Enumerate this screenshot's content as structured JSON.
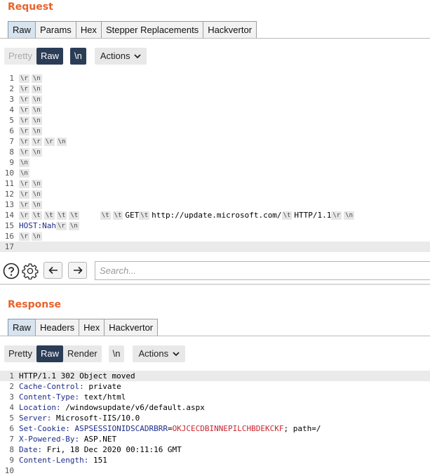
{
  "request": {
    "title": "Request",
    "tabs": [
      "Raw",
      "Params",
      "Hex",
      "Stepper Replacements",
      "Hackvertor"
    ],
    "toolbar": {
      "pretty": "Pretty",
      "raw": "Raw",
      "newline": "\\n",
      "actions": "Actions"
    },
    "lines": [
      {
        "n": "1",
        "html": "<span class='esc'>\\r</span><span class='esc'>\\n</span>"
      },
      {
        "n": "2",
        "html": "<span class='esc'>\\r</span><span class='esc'>\\n</span>"
      },
      {
        "n": "3",
        "html": "<span class='esc'>\\r</span><span class='esc'>\\n</span>"
      },
      {
        "n": "4",
        "html": "<span class='esc'>\\r</span><span class='esc'>\\n</span>"
      },
      {
        "n": "5",
        "html": "<span class='esc'>\\r</span><span class='esc'>\\n</span>"
      },
      {
        "n": "6",
        "html": "<span class='esc'>\\r</span><span class='esc'>\\n</span>"
      },
      {
        "n": "7",
        "html": "<span class='esc'>\\r</span><span class='esc'>\\r</span><span class='esc'>\\r</span><span class='esc'>\\n</span>"
      },
      {
        "n": "8",
        "html": "<span class='esc'>\\r</span><span class='esc'>\\n</span>"
      },
      {
        "n": "9",
        "html": "<span class='esc'>\\n</span>"
      },
      {
        "n": "10",
        "html": "<span class='esc'>\\n</span>"
      },
      {
        "n": "11",
        "html": "<span class='esc'>\\r</span><span class='esc'>\\n</span>"
      },
      {
        "n": "12",
        "html": "<span class='esc'>\\r</span><span class='esc'>\\n</span>"
      },
      {
        "n": "13",
        "html": "<span class='esc'>\\r</span><span class='esc'>\\n</span>"
      },
      {
        "n": "14",
        "html": "<span class='esc'>\\r</span><span class='esc'>\\t</span><span class='esc'>\\t</span><span class='esc'>\\t</span><span class='esc'>\\t</span>    <span class='esc'>\\t</span><span class='esc'>\\t</span>GET<span class='esc'>\\t</span>http://update.microsoft.com/<span class='esc'>\\t</span>HTTP/1.1<span class='esc'>\\r</span><span class='esc'>\\n</span>"
      },
      {
        "n": "15",
        "html": "<span class='hk'>HOST:</span><span class='hk'>Nah</span><span class='esc'>\\r</span><span class='esc'>\\n</span>"
      },
      {
        "n": "16",
        "html": "<span class='esc'>\\r</span><span class='esc'>\\n</span>"
      },
      {
        "n": "17",
        "html": ""
      }
    ],
    "search_placeholder": "Search..."
  },
  "response": {
    "title": "Response",
    "tabs": [
      "Raw",
      "Headers",
      "Hex",
      "Hackvertor"
    ],
    "toolbar": {
      "pretty": "Pretty",
      "raw": "Raw",
      "render": "Render",
      "newline": "\\n",
      "actions": "Actions"
    },
    "lines": [
      {
        "n": "1",
        "html": "HTTP/1.1 302 Object moved"
      },
      {
        "n": "2",
        "html": "<span class='hk'>Cache-Control:</span> private"
      },
      {
        "n": "3",
        "html": "<span class='hk'>Content-Type:</span> text/html"
      },
      {
        "n": "4",
        "html": "<span class='hk'>Location:</span> /windowsupdate/v6/default.aspx"
      },
      {
        "n": "5",
        "html": "<span class='hk'>Server:</span> Microsoft-IIS/10.0"
      },
      {
        "n": "6",
        "html": "<span class='hk'>Set-Cookie:</span> <span class='hk'>ASPSESSIONIDSCADRBRR</span>=<span class='cval'>OKJCECDBINNEPILCHBDEKCKF</span>; path=/"
      },
      {
        "n": "7",
        "html": "<span class='hk'>X-Powered-By:</span> ASP.NET"
      },
      {
        "n": "8",
        "html": "<span class='hk'>Date:</span> Fri, 18 Dec 2020 00:11:16 GMT"
      },
      {
        "n": "9",
        "html": "<span class='hk'>Content-Length:</span> 151"
      },
      {
        "n": "10",
        "html": ""
      }
    ]
  }
}
